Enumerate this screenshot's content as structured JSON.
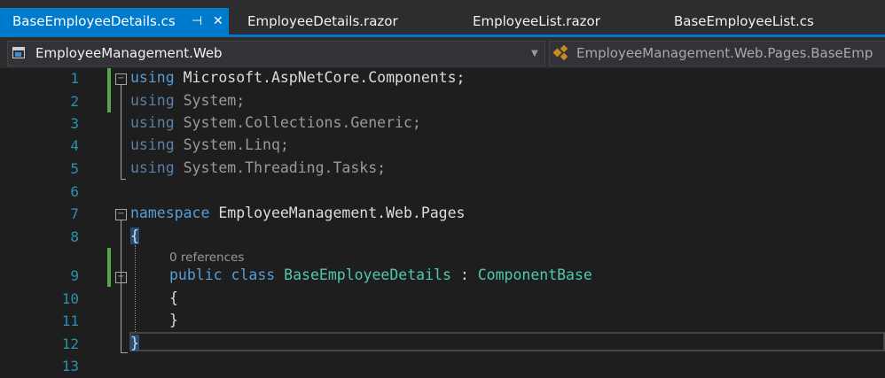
{
  "tabs": [
    {
      "label": "BaseEmployeeDetails.cs",
      "active": true
    },
    {
      "label": "EmployeeDetails.razor",
      "active": false
    },
    {
      "label": "EmployeeList.razor",
      "active": false
    },
    {
      "label": "BaseEmployeeList.cs",
      "active": false
    }
  ],
  "tab_icons": {
    "pin": "pin-icon",
    "close": "close-icon"
  },
  "navbar": {
    "project": "EmployeeManagement.Web",
    "type_scope": "EmployeeManagement.Web.Pages.BaseEmp"
  },
  "editor": {
    "line_numbers": [
      "1",
      "2",
      "3",
      "4",
      "5",
      "6",
      "7",
      "8",
      "9",
      "10",
      "11",
      "12",
      "13"
    ],
    "codelens_references": "0 references",
    "lines": {
      "l1_kw": "using",
      "l1_rest": " Microsoft.AspNetCore.Components;",
      "l2_kw": "using",
      "l2_rest": " System;",
      "l3_kw": "using",
      "l3_rest": " System.Collections.Generic;",
      "l4_kw": "using",
      "l4_rest": " System.Linq;",
      "l5_kw": "using",
      "l5_rest": " System.Threading.Tasks;",
      "l7_kw": "namespace",
      "l7_rest": " EmployeeManagement.Web.Pages",
      "l8": "{",
      "l9_kw1": "public",
      "l9_kw2": "class",
      "l9_name": "BaseEmployeeDetails",
      "l9_colon": " : ",
      "l9_base": "ComponentBase",
      "l10": "{",
      "l11": "}",
      "l12": "}"
    }
  },
  "colors": {
    "tab_active": "#007acc",
    "keyword": "#569cd6",
    "type": "#4ec9b0",
    "line_number": "#2b91af",
    "change_marker": "#57a64a"
  }
}
